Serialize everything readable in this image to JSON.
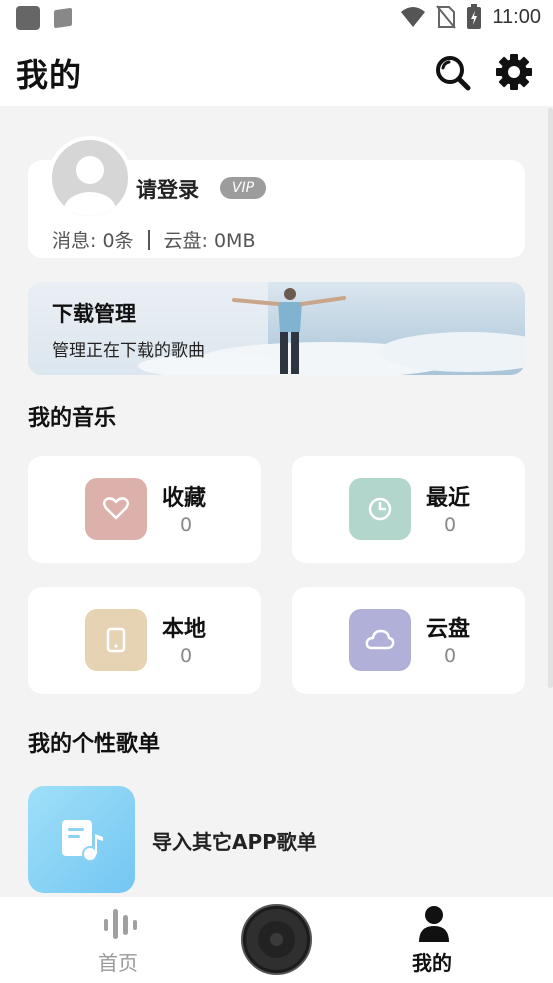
{
  "status_bar": {
    "time": "11:00"
  },
  "header": {
    "title": "我的",
    "search_icon": "search-icon",
    "settings_icon": "gear-icon"
  },
  "profile": {
    "login_label": "请登录",
    "vip_label": "VIP",
    "messages": "消息: 0条",
    "cloud_usage": "云盘: 0MB"
  },
  "download_banner": {
    "title": "下载管理",
    "subtitle": "管理正在下载的歌曲"
  },
  "my_music": {
    "title": "我的音乐",
    "tiles": [
      {
        "label": "收藏",
        "count": "0",
        "icon": "heart-icon",
        "color": "#dcb0ab"
      },
      {
        "label": "最近",
        "count": "0",
        "icon": "clock-icon",
        "color": "#b2d6cc"
      },
      {
        "label": "本地",
        "count": "0",
        "icon": "phone-icon",
        "color": "#e6d3b3"
      },
      {
        "label": "云盘",
        "count": "0",
        "icon": "cloud-icon",
        "color": "#b0b0d9"
      }
    ]
  },
  "playlists": {
    "title": "我的个性歌单",
    "import_label": "导入其它APP歌单"
  },
  "bottom_nav": {
    "home_label": "首页",
    "mine_label": "我的"
  }
}
